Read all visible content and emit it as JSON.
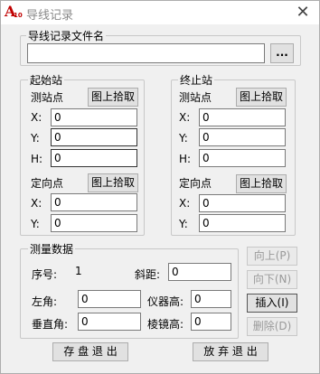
{
  "window": {
    "title": "导线记录",
    "icon_label": "A10"
  },
  "file": {
    "legend": "导线记录文件名",
    "value": "",
    "browse_label": "..."
  },
  "start": {
    "legend": "起始站",
    "survey_label": "测站点",
    "pick1_label": "图上拾取",
    "x_label": "X:",
    "x_value": "0",
    "y_label": "Y:",
    "y_value": "0",
    "h_label": "H:",
    "h_value": "0",
    "orient_label": "定向点",
    "pick2_label": "图上拾取",
    "ox_label": "X:",
    "ox_value": "0",
    "oy_label": "Y:",
    "oy_value": "0"
  },
  "end": {
    "legend": "终止站",
    "survey_label": "测站点",
    "pick1_label": "图上拾取",
    "x_label": "X:",
    "x_value": "0",
    "y_label": "Y:",
    "y_value": "0",
    "h_label": "H:",
    "h_value": "0",
    "orient_label": "定向点",
    "pick2_label": "图上拾取",
    "ox_label": "X:",
    "ox_value": "0",
    "oy_label": "Y:",
    "oy_value": "0"
  },
  "measure": {
    "legend": "测量数据",
    "seq_label": "序号:",
    "seq_value": "1",
    "slope_label": "斜距:",
    "slope_value": "0",
    "left_angle_label": "左角:",
    "left_angle_value": "0",
    "inst_height_label": "仪器高:",
    "inst_height_value": "0",
    "vert_angle_label": "垂直角:",
    "vert_angle_value": "0",
    "prism_height_label": "棱镜高:",
    "prism_height_value": "0"
  },
  "side_buttons": {
    "up": "向上(P)",
    "down": "向下(N)",
    "insert": "插入(I)",
    "delete": "删除(D)"
  },
  "footer": {
    "save_exit": "存 盘 退 出",
    "discard_exit": "放 弃 退 出"
  }
}
